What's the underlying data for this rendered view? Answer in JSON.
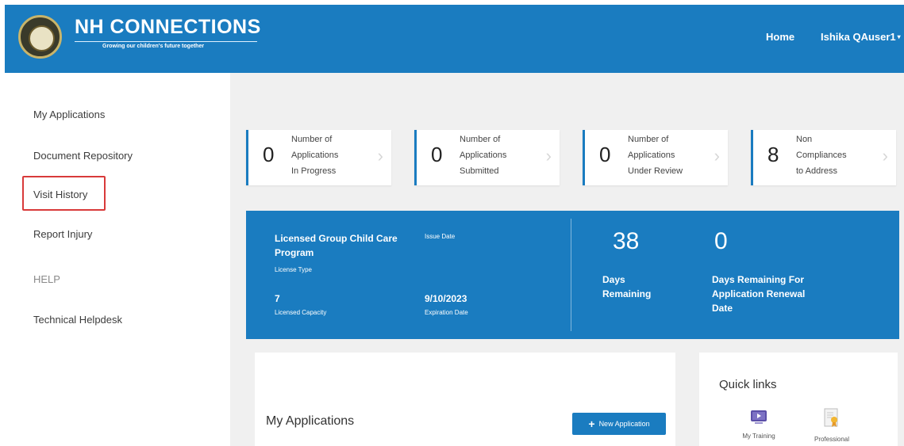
{
  "header": {
    "brand_title": "NH CONNECTIONS",
    "brand_tagline": "Growing our children's future together",
    "nav_home": "Home",
    "user_name": "Ishika QAuser1",
    "caret": "▾"
  },
  "sidebar": {
    "items": [
      {
        "label": "My Applications"
      },
      {
        "label": "Document Repository"
      },
      {
        "label": "Visit History"
      },
      {
        "label": "Report Injury"
      },
      {
        "label": "HELP"
      },
      {
        "label": "Technical Helpdesk"
      }
    ]
  },
  "stats": [
    {
      "value": "0",
      "label": [
        "Number of",
        "Applications",
        "In Progress"
      ]
    },
    {
      "value": "0",
      "label": [
        "Number of",
        "Applications",
        "Submitted"
      ]
    },
    {
      "value": "0",
      "label": [
        "Number of",
        "Applications",
        "Under Review"
      ]
    },
    {
      "value": "8",
      "label": [
        "Non",
        "Compliances",
        "to Address"
      ]
    }
  ],
  "license": {
    "program_name": "Licensed Group Child Care Program",
    "license_type_label": "License Type",
    "issue_date_label": "Issue Date",
    "capacity_value": "7",
    "capacity_label": "Licensed Capacity",
    "expiration_value": "9/10/2023",
    "expiration_label": "Expiration Date",
    "days_remaining_value": "38",
    "days_remaining_label": "Days Remaining",
    "renewal_value": "0",
    "renewal_label": "Days Remaining For Application Renewal Date"
  },
  "applications": {
    "title": "My Applications",
    "new_button_label": "New Application",
    "plus": "+"
  },
  "quick_links": {
    "title": "Quick links",
    "items": [
      {
        "label": "My Training"
      },
      {
        "label": "Professional"
      }
    ]
  },
  "colors": {
    "brand_blue": "#1a7cc0",
    "highlight_red": "#d83a3a"
  }
}
